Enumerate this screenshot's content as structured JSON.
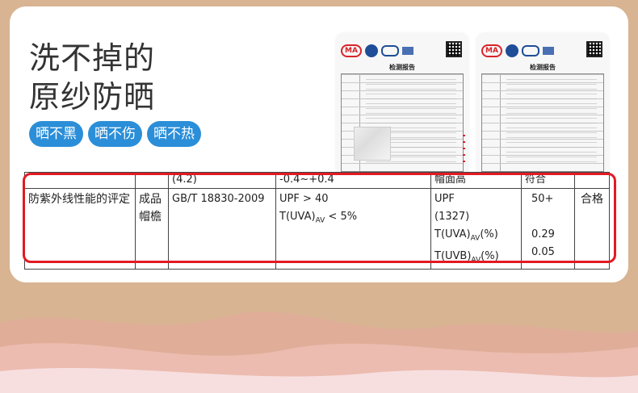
{
  "headline": {
    "line1": "洗不掉的",
    "line2": "原纱防晒"
  },
  "tags": [
    "晒不黑",
    "晒不伤",
    "晒不热"
  ],
  "thumbnails": [
    {
      "seal": "MA",
      "title": "检测报告"
    },
    {
      "seal": "MA",
      "title": "检测报告"
    }
  ],
  "table": {
    "top_row": {
      "c3": "(4.2)",
      "c4": "-0.4~+0.4",
      "c5": "帽面高",
      "c6": "符合"
    },
    "row": {
      "item": "防紫外线性能的评定",
      "sample": "成品\n帽檐",
      "standard": "GB/T  18830-2009",
      "requirement_1": "UPF > 40",
      "requirement_2_pre": "T(UVA)",
      "requirement_2_sub": "AV",
      "requirement_2_post": " < 5%",
      "result_labels": [
        {
          "pre": "UPF",
          "sub": "",
          "post": ""
        },
        {
          "pre": "(1327)",
          "sub": "",
          "post": ""
        },
        {
          "pre": "T(UVA)",
          "sub": "AV",
          "post": "(%)"
        },
        {
          "pre": "T(UVB)",
          "sub": "AV",
          "post": "(%)"
        }
      ],
      "result_values": [
        "50+",
        "",
        "0.29",
        "0.05"
      ],
      "grade": "合格"
    }
  },
  "colors": {
    "accent": "#2b8ed8",
    "highlight": "#e21a22",
    "background": "#d8b492"
  }
}
